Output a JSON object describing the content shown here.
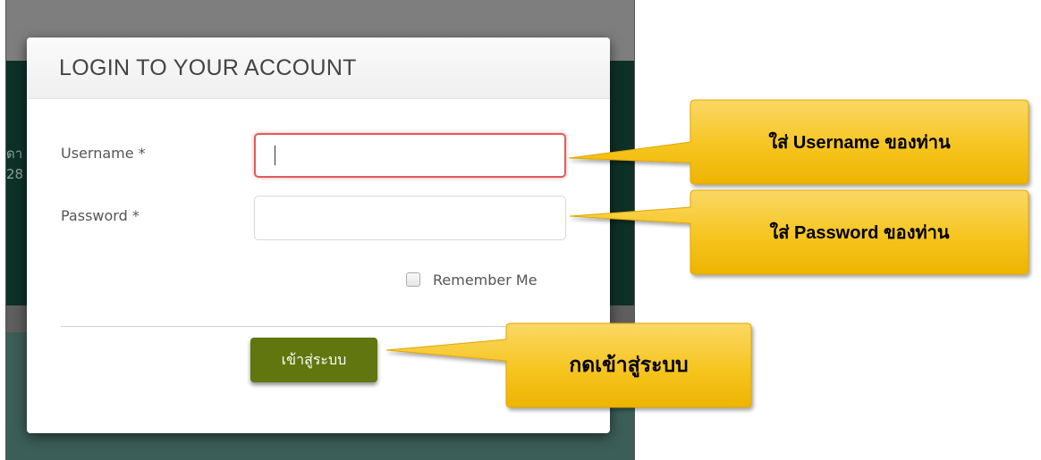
{
  "background": {
    "partial_text_1": "ดา",
    "partial_text_2": "28"
  },
  "modal": {
    "title": "LOGIN TO YOUR ACCOUNT",
    "username_label": "Username *",
    "password_label": "Password *",
    "username_value": "",
    "password_value": "",
    "remember_label": "Remember Me",
    "remember_checked": false,
    "login_button_label": "เข้าสู่ระบบ"
  },
  "callouts": {
    "username": "ใส่ Username ของท่าน",
    "password": "ใส่ Password ของท่าน",
    "login": "กดเข้าสู่ระบบ"
  },
  "colors": {
    "callout_fill": "#f5c21a",
    "login_button": "#61760f",
    "focus_border": "#e35b5b",
    "page_band": "#0d3127"
  }
}
